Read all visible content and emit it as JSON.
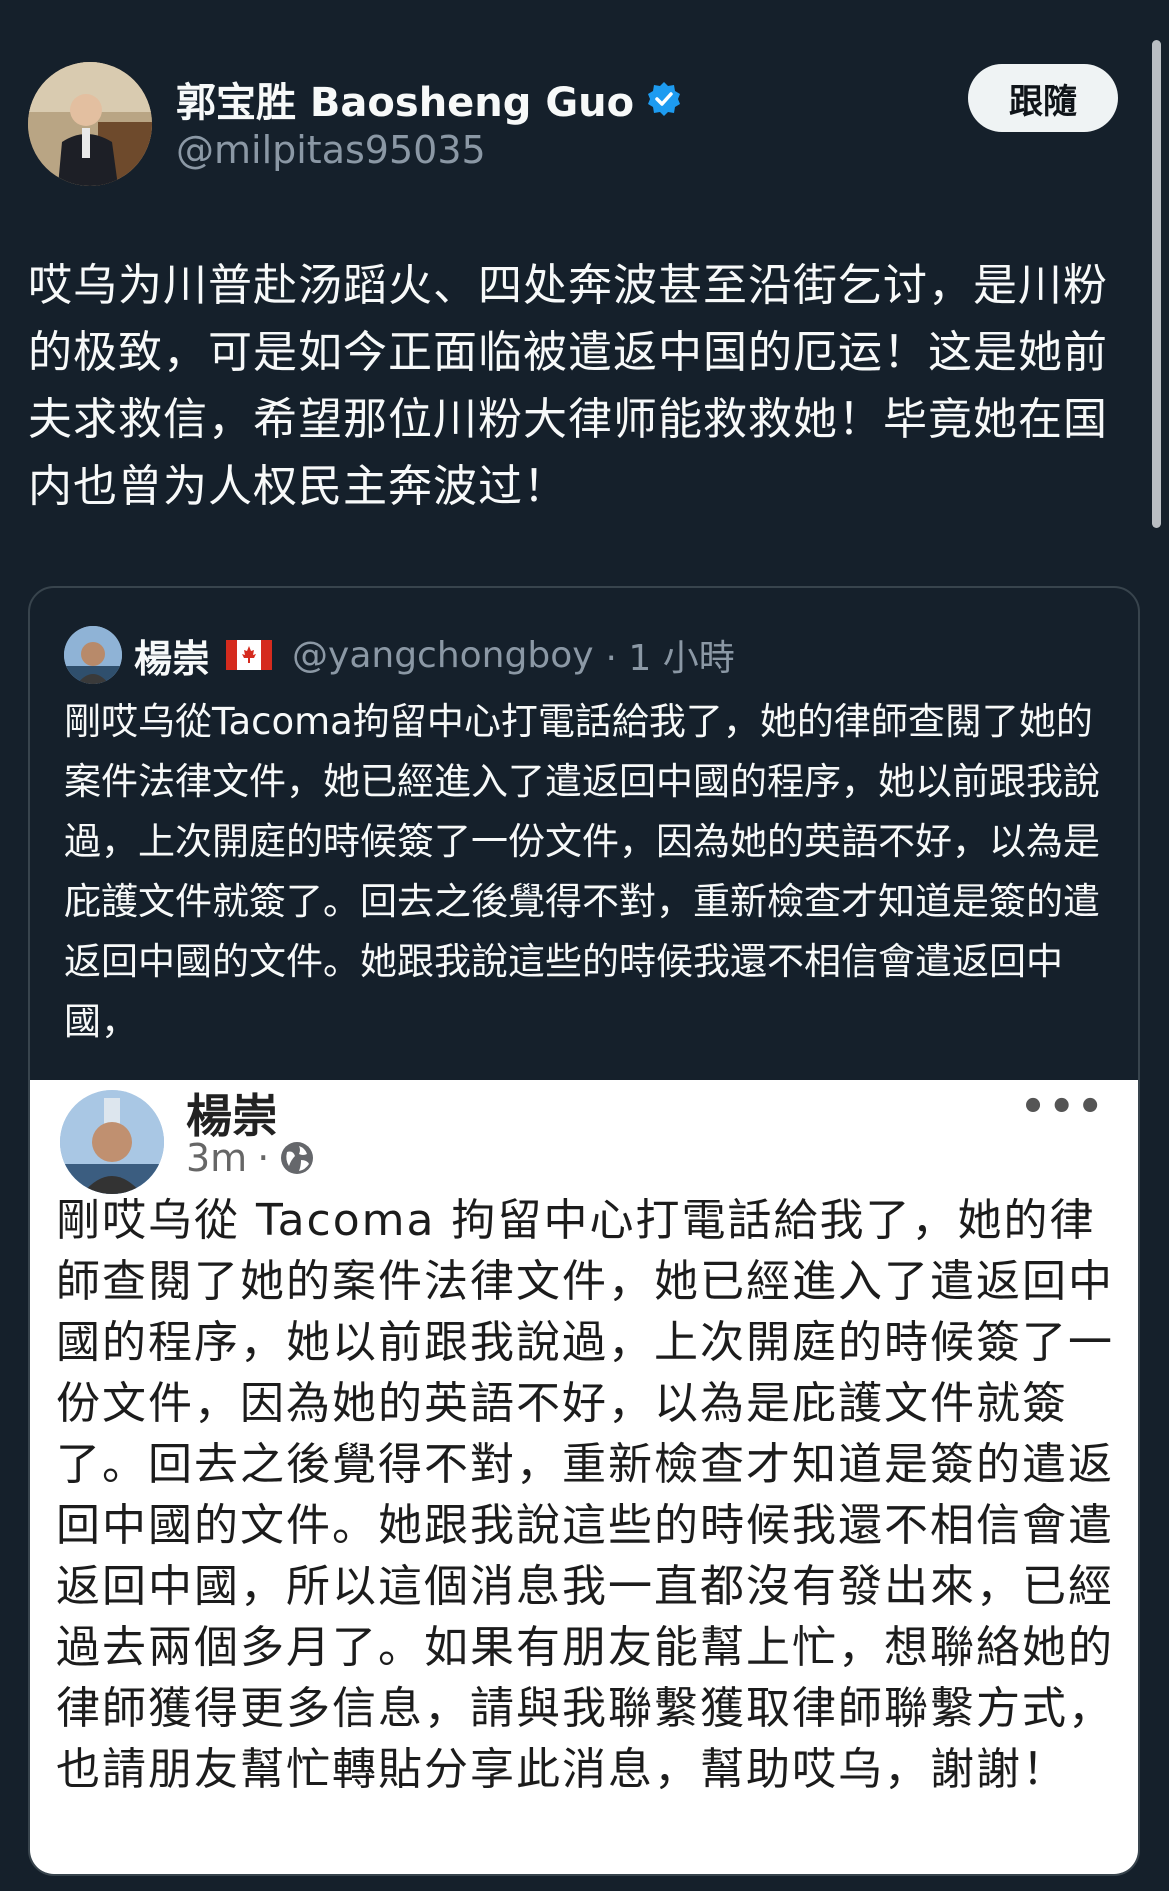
{
  "author": {
    "display_name": "郭宝胜 Baosheng Guo",
    "handle": "@milpitas95035",
    "verified": true
  },
  "follow_button": {
    "label": "跟隨"
  },
  "tweet": {
    "text": "哎乌为川普赴汤蹈火、四处奔波甚至沿街乞讨，是川粉的极致，可是如今正面临被遣返中国的厄运！这是她前夫求救信，希望那位川粉大律师能救救她！毕竟她在国内也曾为人权民主奔波过！"
  },
  "quoted_tweet": {
    "display_name": "楊崇",
    "flag_icon": "canada-flag-icon",
    "handle": "@yangchongboy",
    "time": "· 1 小時",
    "text": "剛哎乌從Tacoma拘留中心打電話給我了，她的律師查閱了她的案件法律文件，她已經進入了遣返回中國的程序，她以前跟我說過，上次開庭的時候簽了一份文件，因為她的英語不好，以為是庇護文件就簽了。回去之後覺得不對，重新檢查才知道是簽的遣返回中國的文件。她跟我說這些的時候我還不相信會遣返回中國，"
  },
  "embedded_post": {
    "name": "楊崇",
    "time": "3m",
    "separator": "·",
    "visibility_icon": "globe-icon",
    "more_icon": "more-horizontal-icon",
    "more_label": "•••",
    "text": "剛哎乌從 Tacoma 拘留中心打電話給我了，她的律師查閱了她的案件法律文件，她已經進入了遣返回中國的程序，她以前跟我說過，上次開庭的時候簽了一份文件，因為她的英語不好，以為是庇護文件就簽了。回去之後覺得不對，重新檢查才知道是簽的遣返回中國的文件。她跟我說這些的時候我還不相信會遣返回中國，所以這個消息我一直都沒有發出來，已經過去兩個多月了。如果有朋友能幫上忙，想聯絡她的律師獲得更多信息，請與我聯繫獲取律師聯繫方式，也請朋友幫忙轉貼分享此消息，幫助哎乌，謝謝！"
  },
  "colors": {
    "background": "#15202b",
    "text_primary": "#f7f9f9",
    "text_secondary": "#8b98a5",
    "verified_blue": "#1d9bf0",
    "card_border": "#38444d"
  }
}
